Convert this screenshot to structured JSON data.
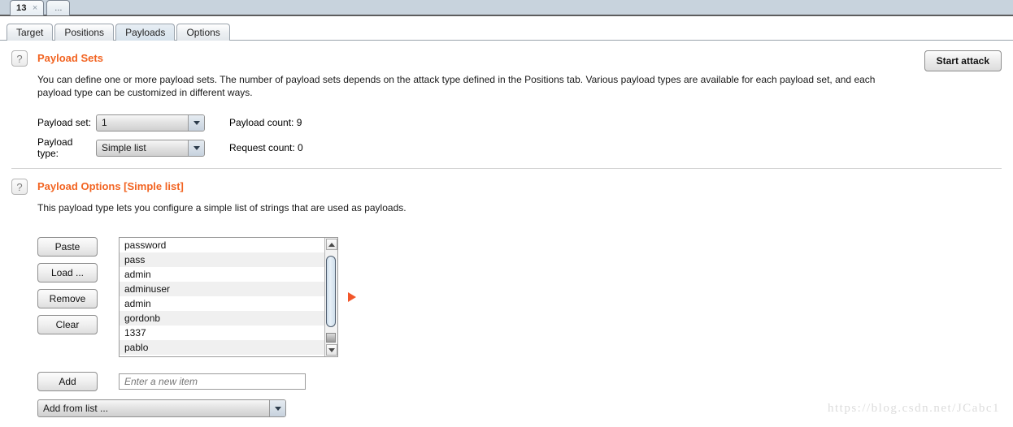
{
  "window_tabs": [
    {
      "label": "13",
      "close": "×",
      "selected": true
    },
    {
      "label": "...",
      "selected": false
    }
  ],
  "main_tabs": [
    {
      "label": "Target",
      "active": false
    },
    {
      "label": "Positions",
      "active": false
    },
    {
      "label": "Payloads",
      "active": true
    },
    {
      "label": "Options",
      "active": false
    }
  ],
  "payload_sets": {
    "help_icon": "question-mark-icon",
    "title": "Payload Sets",
    "description": "You can define one or more payload sets. The number of payload sets depends on the attack type defined in the Positions tab. Various payload types are available for each payload set, and each payload type can be customized in different ways.",
    "payload_set_label": "Payload set:",
    "payload_set_value": "1",
    "payload_type_label": "Payload type:",
    "payload_type_value": "Simple list",
    "payload_count_label": "Payload count:  9",
    "request_count_label": "Request count:  0",
    "start_attack_label": "Start attack"
  },
  "payload_options": {
    "help_icon": "question-mark-icon",
    "title": "Payload Options [Simple list]",
    "description": "This payload type lets you configure a simple list of strings that are used as payloads.",
    "buttons": [
      {
        "label": "Paste"
      },
      {
        "label": "Load ..."
      },
      {
        "label": "Remove"
      },
      {
        "label": "Clear"
      }
    ],
    "items": [
      "password",
      "pass",
      "admin",
      "adminuser",
      "admin",
      "gordonb",
      "1337",
      "pablo"
    ],
    "add_button_label": "Add",
    "add_input_placeholder": "Enter a new item",
    "add_from_list_value": "Add from list ..."
  },
  "watermark": "https://blog.csdn.net/JCabc1",
  "colors": {
    "accent_orange": "#f26422",
    "arrow_orange": "#f2562a",
    "titlebar_blue": "#c8d3dd"
  }
}
